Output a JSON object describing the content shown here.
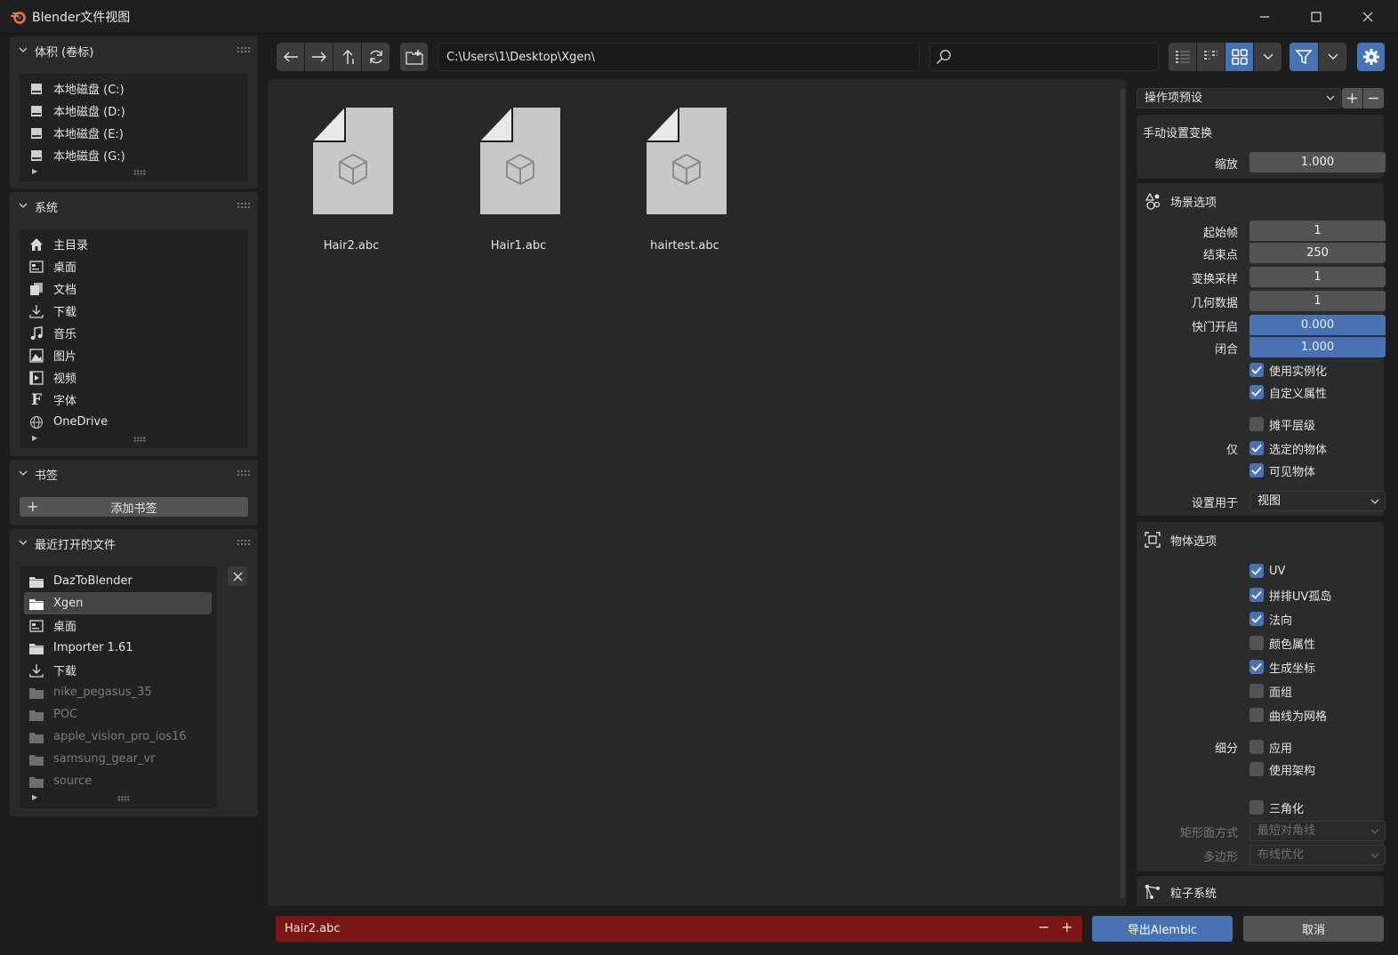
{
  "window": {
    "title": "Blender文件视图",
    "accent": "#4772b3",
    "error_color": "#7b1414"
  },
  "sidebar": {
    "volumes": {
      "title": "体积 (卷标)",
      "items": [
        {
          "label": "本地磁盘 (C:)",
          "icon": "disk-icon"
        },
        {
          "label": "本地磁盘 (D:)",
          "icon": "disk-icon"
        },
        {
          "label": "本地磁盘 (E:)",
          "icon": "disk-icon"
        },
        {
          "label": "本地磁盘 (G:)",
          "icon": "disk-icon"
        }
      ]
    },
    "system": {
      "title": "系统",
      "items": [
        {
          "label": "主目录",
          "icon": "home-icon"
        },
        {
          "label": "桌面",
          "icon": "desktop-icon"
        },
        {
          "label": "文档",
          "icon": "documents-icon"
        },
        {
          "label": "下载",
          "icon": "download-icon"
        },
        {
          "label": "音乐",
          "icon": "music-icon"
        },
        {
          "label": "图片",
          "icon": "image-icon"
        },
        {
          "label": "视频",
          "icon": "video-icon"
        },
        {
          "label": "字体",
          "icon": "font-icon"
        },
        {
          "label": "OneDrive",
          "icon": "globe-icon"
        }
      ]
    },
    "bookmarks": {
      "title": "书签",
      "add_label": "添加书签"
    },
    "recent": {
      "title": "最近打开的文件",
      "items": [
        {
          "label": "DazToBlender",
          "icon": "folder-icon",
          "state": "normal"
        },
        {
          "label": "Xgen",
          "icon": "folder-icon",
          "state": "selected"
        },
        {
          "label": "桌面",
          "icon": "desktop-icon",
          "state": "normal"
        },
        {
          "label": "Importer 1.61",
          "icon": "folder-icon",
          "state": "normal"
        },
        {
          "label": "下载",
          "icon": "download-icon",
          "state": "normal"
        },
        {
          "label": "nike_pegasus_35",
          "icon": "folder-icon",
          "state": "dim"
        },
        {
          "label": "POC",
          "icon": "folder-icon",
          "state": "dim"
        },
        {
          "label": "apple_vision_pro_ios16",
          "icon": "folder-icon",
          "state": "dim"
        },
        {
          "label": "samsung_gear_vr",
          "icon": "folder-icon",
          "state": "dim"
        },
        {
          "label": "source",
          "icon": "folder-icon",
          "state": "dim"
        }
      ]
    }
  },
  "toolbar": {
    "path": "C:\\Users\\1\\Desktop\\Xgen\\",
    "search_placeholder": ""
  },
  "files": [
    {
      "name": "Hair2.abc",
      "icon": "alembic-file-icon"
    },
    {
      "name": "Hair1.abc",
      "icon": "alembic-file-icon"
    },
    {
      "name": "hairtest.abc",
      "icon": "alembic-file-icon"
    }
  ],
  "props": {
    "preset_label": "操作项预设",
    "manual_transform": {
      "title": "手动设置变换",
      "scale_label": "缩放",
      "scale_value": "1.000"
    },
    "scene": {
      "title": "场景选项",
      "start_label": "起始帧",
      "start_value": "1",
      "end_label": "结束点",
      "end_value": "250",
      "xform_label": "变换采样",
      "xform_value": "1",
      "geom_label": "几何数据",
      "geom_value": "1",
      "shutter_open_label": "快门开启",
      "shutter_open_value": "0.000",
      "shutter_close_label": "闭合",
      "shutter_close_value": "1.000",
      "use_instancing": "使用实例化",
      "custom_props": "自定义属性",
      "flatten": "摊平层级",
      "only_label": "仅",
      "selected": "选定的物体",
      "visible": "可见物体",
      "settings_for_label": "设置用于",
      "settings_for_value": "视图"
    },
    "object": {
      "title": "物体选项",
      "uv": "UV",
      "pack_uv": "拼排UV孤岛",
      "normals": "法向",
      "vcolors": "颜色属性",
      "orcos": "生成坐标",
      "face_sets": "面组",
      "curves_mesh": "曲线为网格",
      "subdiv_label": "细分",
      "apply": "应用",
      "use_schema": "使用架构",
      "triangulate": "三角化",
      "quad_label": "矩形面方式",
      "quad_value": "最短对角线",
      "ngon_label": "多边形",
      "ngon_value": "布线优化"
    },
    "particles": {
      "title": "粒子系统"
    }
  },
  "bottom": {
    "filename": "Hair2.abc",
    "export_label": "导出Alembic",
    "cancel_label": "取消"
  }
}
